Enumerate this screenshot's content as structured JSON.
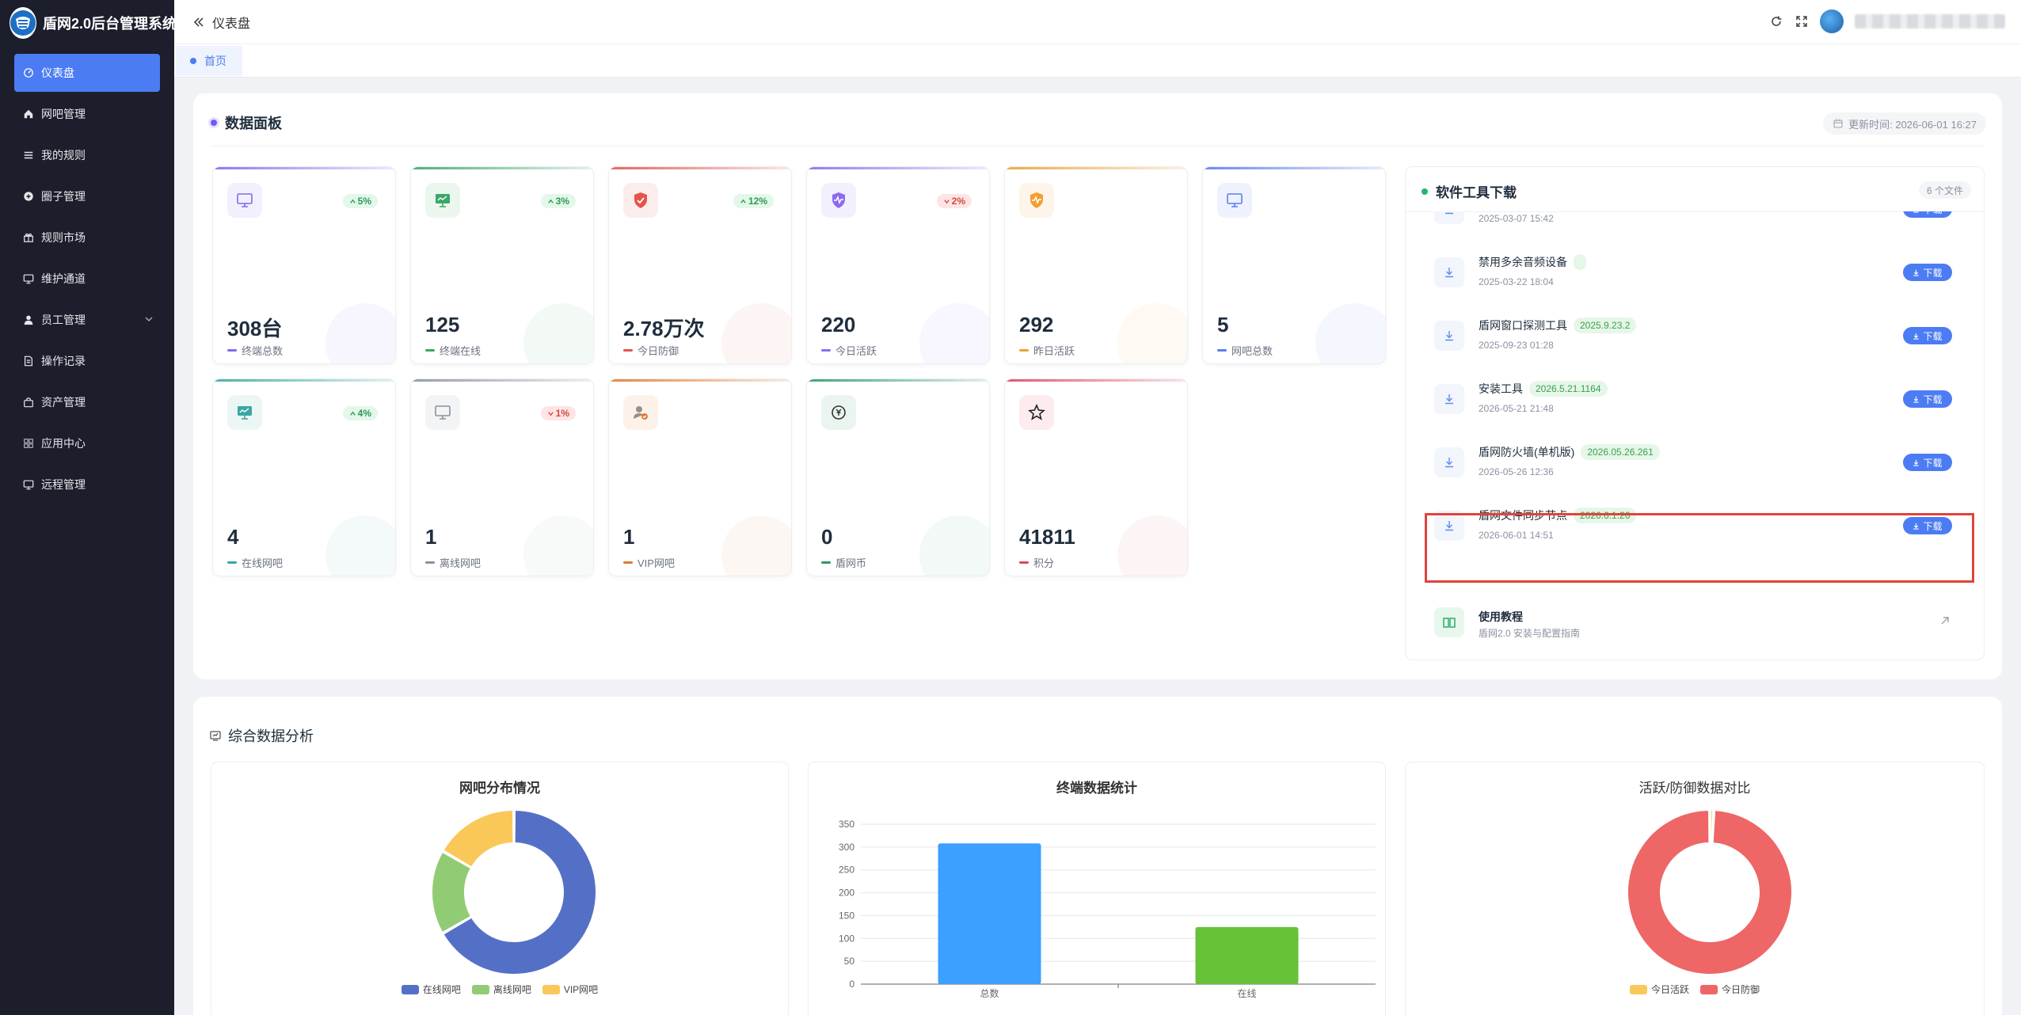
{
  "app": {
    "title": "盾网2.0后台管理系统"
  },
  "sidebar": {
    "items": [
      {
        "label": "仪表盘",
        "icon": "dashboard-icon",
        "active": true
      },
      {
        "label": "网吧管理",
        "icon": "home-icon"
      },
      {
        "label": "我的规则",
        "icon": "list-icon"
      },
      {
        "label": "圈子管理",
        "icon": "circle-icon"
      },
      {
        "label": "规则市场",
        "icon": "gift-icon"
      },
      {
        "label": "维护通道",
        "icon": "monitor-icon"
      },
      {
        "label": "员工管理",
        "icon": "user-icon",
        "expandable": true
      },
      {
        "label": "操作记录",
        "icon": "document-icon"
      },
      {
        "label": "资产管理",
        "icon": "bag-icon"
      },
      {
        "label": "应用中心",
        "icon": "grid-icon"
      },
      {
        "label": "远程管理",
        "icon": "monitor-icon"
      }
    ]
  },
  "header": {
    "title": "仪表盘"
  },
  "tabs": [
    {
      "label": "首页"
    }
  ],
  "dashboard": {
    "title": "数据面板",
    "updated": "更新时间: 2026-06-01 16:27",
    "stats": [
      {
        "value": "308台",
        "label": "终端总数",
        "trend": "5%",
        "dir": "up",
        "color": "#7c6cf0",
        "icon": "monitor-icon"
      },
      {
        "value": "125",
        "label": "终端在线",
        "trend": "3%",
        "dir": "up",
        "color": "#3aa866",
        "icon": "monitor-online-icon"
      },
      {
        "value": "2.78万次",
        "label": "今日防御",
        "trend": "12%",
        "dir": "up",
        "color": "#e5534b",
        "icon": "shield-icon"
      },
      {
        "value": "220",
        "label": "今日活跃",
        "trend": "2%",
        "dir": "down",
        "color": "#8b6cf0",
        "icon": "shield-heartbeat-icon"
      },
      {
        "value": "292",
        "label": "昨日活跃",
        "trend": "",
        "dir": "",
        "color": "#f0a030",
        "icon": "shield-heartbeat-icon"
      },
      {
        "value": "5",
        "label": "网吧总数",
        "trend": "",
        "dir": "",
        "color": "#5b7cf0",
        "icon": "monitor-icon"
      },
      {
        "value": "4",
        "label": "在线网吧",
        "trend": "4%",
        "dir": "up",
        "color": "#3aa8a0",
        "icon": "monitor-online-icon"
      },
      {
        "value": "1",
        "label": "离线网吧",
        "trend": "1%",
        "dir": "down",
        "color": "#8a919f",
        "icon": "monitor-offline-icon"
      },
      {
        "value": "1",
        "label": "VIP网吧",
        "trend": "",
        "dir": "",
        "color": "#e07b30",
        "icon": "vip-user-icon"
      },
      {
        "value": "0",
        "label": "盾网币",
        "trend": "",
        "dir": "",
        "color": "#2f9a6a",
        "icon": "coin-icon"
      },
      {
        "value": "41811",
        "label": "积分",
        "trend": "",
        "dir": "",
        "color": "#e0455b",
        "icon": "star-icon"
      }
    ]
  },
  "downloads": {
    "title": "软件工具下载",
    "count": "6 个文件",
    "button_label": "下载",
    "items": [
      {
        "name": "",
        "version": "",
        "date": "2025-03-07 15:42"
      },
      {
        "name": "禁用多余音频设备",
        "version": "",
        "date": "2025-03-22 18:04"
      },
      {
        "name": "盾网窗口探测工具",
        "version": "2025.9.23.2",
        "date": "2025-09-23 01:28"
      },
      {
        "name": "安装工具",
        "version": "2026.5.21.1164",
        "date": "2026-05-21 21:48"
      },
      {
        "name": "盾网防火墙(单机版)",
        "version": "2026.05.26.261",
        "date": "2026-05-26 12:36"
      },
      {
        "name": "盾网文件同步节点",
        "version": "2026.6.1.26",
        "date": "2026-06-01 14:51"
      }
    ],
    "tutorial": {
      "title": "使用教程",
      "subtitle": "盾网2.0 安装与配置指南"
    }
  },
  "analysis": {
    "title": "综合数据分析"
  },
  "chart_data": [
    {
      "type": "pie",
      "title": "网吧分布情况",
      "categories": [
        "在线网吧",
        "离线网吧",
        "VIP网吧"
      ],
      "values": [
        4,
        1,
        1
      ],
      "colors": [
        "#5470c6",
        "#91cc75",
        "#fac858"
      ],
      "donut": true,
      "legend": "bottom"
    },
    {
      "type": "bar",
      "title": "终端数据统计",
      "categories": [
        "总数",
        "在线"
      ],
      "values": [
        308,
        125
      ],
      "colors": [
        "#3ba0ff",
        "#67c23a"
      ],
      "ylim": [
        0,
        350
      ],
      "yticks": [
        0,
        50,
        100,
        150,
        200,
        250,
        300,
        350
      ],
      "grid": true
    },
    {
      "type": "pie",
      "title": "活跃/防御数据对比",
      "categories": [
        "今日活跃",
        "今日防御"
      ],
      "values": [
        220,
        27800
      ],
      "colors": [
        "#fac858",
        "#ee6666"
      ],
      "donut": true,
      "legend": "bottom"
    }
  ]
}
